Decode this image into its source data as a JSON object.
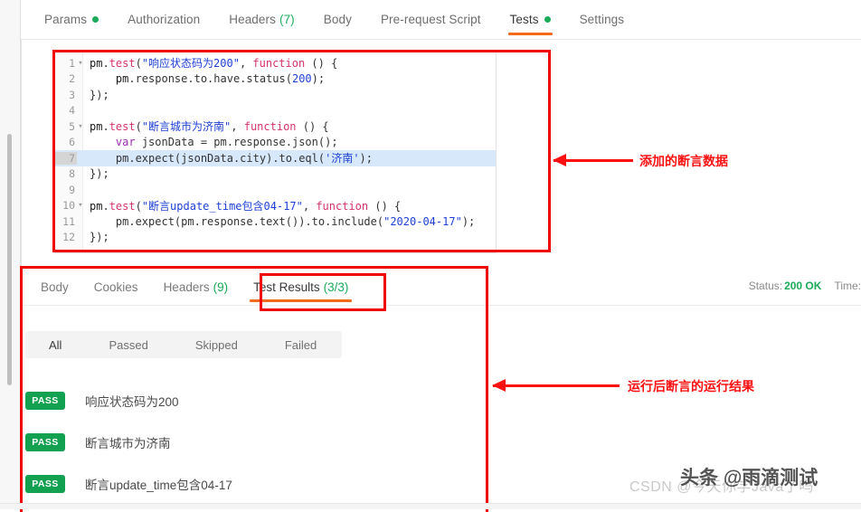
{
  "request_tabs": [
    {
      "label": "Params",
      "dot": true,
      "count": "",
      "active": false
    },
    {
      "label": "Authorization",
      "dot": false,
      "count": "",
      "active": false
    },
    {
      "label": "Headers",
      "dot": false,
      "count": "(7)",
      "active": false
    },
    {
      "label": "Body",
      "dot": false,
      "count": "",
      "active": false
    },
    {
      "label": "Pre-request Script",
      "dot": false,
      "count": "",
      "active": false
    },
    {
      "label": "Tests",
      "dot": true,
      "count": "",
      "active": true
    },
    {
      "label": "Settings",
      "dot": false,
      "count": "",
      "active": false
    }
  ],
  "editor": {
    "lines": [
      {
        "num": "1",
        "fold": "▾",
        "highlight": false,
        "tokens": [
          {
            "t": "pm",
            "c": "k-pm"
          },
          {
            "t": ".",
            "c": "k-pun"
          },
          {
            "t": "test",
            "c": "k-fn"
          },
          {
            "t": "(",
            "c": "k-pun"
          },
          {
            "t": "\"响应状态码为200\"",
            "c": "k-str"
          },
          {
            "t": ", ",
            "c": "k-pun"
          },
          {
            "t": "function",
            "c": "k-fn"
          },
          {
            "t": " () {",
            "c": "k-pun"
          }
        ]
      },
      {
        "num": "2",
        "fold": "",
        "highlight": false,
        "tokens": [
          {
            "t": "    pm",
            "c": "k-pm"
          },
          {
            "t": ".response.to.have.status(",
            "c": "k-pun"
          },
          {
            "t": "200",
            "c": "k-num"
          },
          {
            "t": ");",
            "c": "k-pun"
          }
        ]
      },
      {
        "num": "3",
        "fold": "",
        "highlight": false,
        "tokens": [
          {
            "t": "});",
            "c": "k-pun"
          }
        ]
      },
      {
        "num": "4",
        "fold": "",
        "highlight": false,
        "tokens": [
          {
            "t": "",
            "c": "k-pun"
          }
        ]
      },
      {
        "num": "5",
        "fold": "▾",
        "highlight": false,
        "tokens": [
          {
            "t": "pm",
            "c": "k-pm"
          },
          {
            "t": ".",
            "c": "k-pun"
          },
          {
            "t": "test",
            "c": "k-fn"
          },
          {
            "t": "(",
            "c": "k-pun"
          },
          {
            "t": "\"断言城市为济南\"",
            "c": "k-str"
          },
          {
            "t": ", ",
            "c": "k-pun"
          },
          {
            "t": "function",
            "c": "k-fn"
          },
          {
            "t": " () {",
            "c": "k-pun"
          }
        ]
      },
      {
        "num": "6",
        "fold": "",
        "highlight": false,
        "tokens": [
          {
            "t": "    ",
            "c": "k-pun"
          },
          {
            "t": "var",
            "c": "k-kw"
          },
          {
            "t": " jsonData = pm.response.json();",
            "c": "k-pun"
          }
        ]
      },
      {
        "num": "7",
        "fold": "",
        "highlight": true,
        "tokens": [
          {
            "t": "    pm.expect(jsonData.city).to.eql(",
            "c": "k-pun"
          },
          {
            "t": "'济南'",
            "c": "k-str"
          },
          {
            "t": ");",
            "c": "k-pun"
          }
        ]
      },
      {
        "num": "8",
        "fold": "",
        "highlight": false,
        "tokens": [
          {
            "t": "});",
            "c": "k-pun"
          }
        ]
      },
      {
        "num": "9",
        "fold": "",
        "highlight": false,
        "tokens": [
          {
            "t": "",
            "c": "k-pun"
          }
        ]
      },
      {
        "num": "10",
        "fold": "▾",
        "highlight": false,
        "tokens": [
          {
            "t": "pm",
            "c": "k-pm"
          },
          {
            "t": ".",
            "c": "k-pun"
          },
          {
            "t": "test",
            "c": "k-fn"
          },
          {
            "t": "(",
            "c": "k-pun"
          },
          {
            "t": "\"断言update_time包含04-17\"",
            "c": "k-str"
          },
          {
            "t": ", ",
            "c": "k-pun"
          },
          {
            "t": "function",
            "c": "k-fn"
          },
          {
            "t": " () {",
            "c": "k-pun"
          }
        ]
      },
      {
        "num": "11",
        "fold": "",
        "highlight": false,
        "tokens": [
          {
            "t": "    pm.expect(pm.response.text()).to.include(",
            "c": "k-pun"
          },
          {
            "t": "\"2020-04-17\"",
            "c": "k-str"
          },
          {
            "t": ");",
            "c": "k-pun"
          }
        ]
      },
      {
        "num": "12",
        "fold": "",
        "highlight": false,
        "tokens": [
          {
            "t": "});",
            "c": "k-pun"
          }
        ]
      }
    ]
  },
  "response_tabs": [
    {
      "label": "Body",
      "count": "",
      "active": false
    },
    {
      "label": "Cookies",
      "count": "",
      "active": false
    },
    {
      "label": "Headers",
      "count": "(9)",
      "active": false
    },
    {
      "label": "Test Results",
      "count": "(3/3)",
      "active": true
    }
  ],
  "status": {
    "status_label": "Status:",
    "status_value": "200 OK",
    "time_label": "Time:"
  },
  "filters": [
    {
      "label": "All",
      "active": true
    },
    {
      "label": "Passed",
      "active": false
    },
    {
      "label": "Skipped",
      "active": false
    },
    {
      "label": "Failed",
      "active": false
    }
  ],
  "results": [
    {
      "badge": "PASS",
      "label": "响应状态码为200"
    },
    {
      "badge": "PASS",
      "label": "断言城市为济南"
    },
    {
      "badge": "PASS",
      "label": "断言update_time包含04-17"
    }
  ],
  "annotations": [
    {
      "text": "添加的断言数据"
    },
    {
      "text": "运行后断言的运行结果"
    }
  ],
  "watermarks": {
    "csdn": "CSDN @今天你学Java了吗",
    "toutiao": "头条 @雨滴测试"
  },
  "colors": {
    "accent_orange": "#f26b1d",
    "pass_green": "#12a150",
    "annotation_red": "#fb1111",
    "code_string_blue": "#1d3fd6",
    "code_fn_pink": "#d6336c"
  }
}
